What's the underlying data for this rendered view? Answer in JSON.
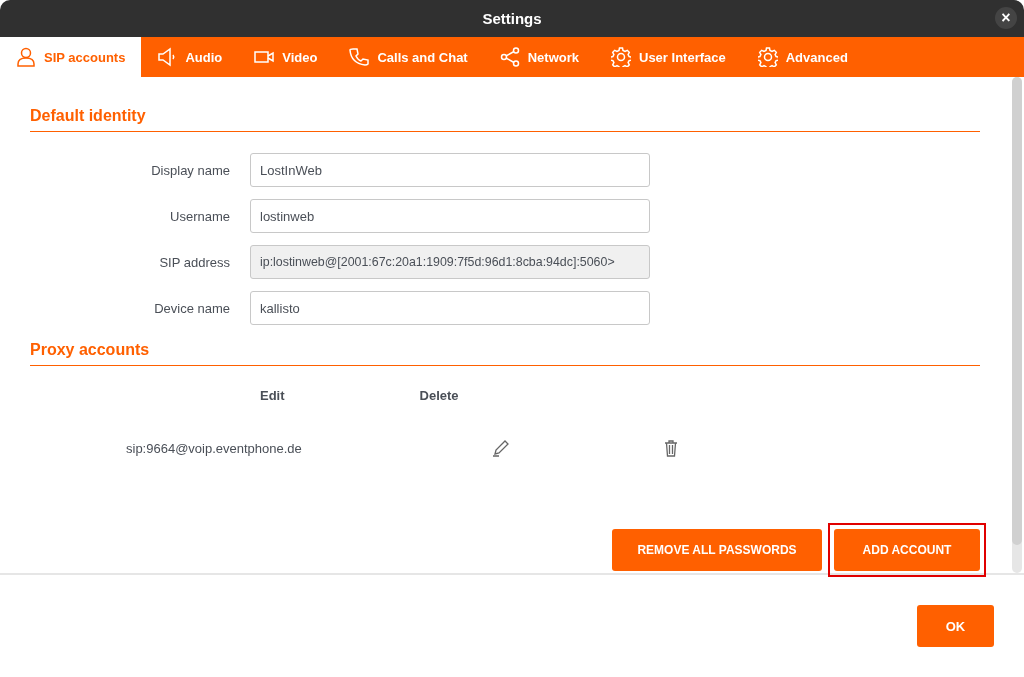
{
  "window": {
    "title": "Settings",
    "close": "×"
  },
  "tabs": [
    {
      "label": "SIP accounts",
      "kind": "user",
      "selected": true
    },
    {
      "label": "Audio",
      "kind": "speaker",
      "selected": false
    },
    {
      "label": "Video",
      "kind": "camera",
      "selected": false
    },
    {
      "label": "Calls and Chat",
      "kind": "phone",
      "selected": false
    },
    {
      "label": "Network",
      "kind": "share",
      "selected": false
    },
    {
      "label": "User Interface",
      "kind": "gear",
      "selected": false
    },
    {
      "label": "Advanced",
      "kind": "gear",
      "selected": false
    }
  ],
  "default_identity": {
    "heading": "Default identity",
    "fields": [
      {
        "label": "Display name",
        "value": "LostInWeb",
        "disabled": false
      },
      {
        "label": "Username",
        "value": "lostinweb",
        "disabled": false
      },
      {
        "label": "SIP address",
        "value": "ip:lostinweb@[2001:67c:20a1:1909:7f5d:96d1:8cba:94dc]:5060>",
        "disabled": true
      },
      {
        "label": "Device name",
        "value": "kallisto",
        "disabled": false
      }
    ]
  },
  "proxy_accounts": {
    "heading": "Proxy accounts",
    "columns": [
      "Edit",
      "Delete"
    ],
    "rows": [
      {
        "address": "sip:9664@voip.eventphone.de"
      }
    ]
  },
  "actions": [
    {
      "label": "REMOVE ALL PASSWORDS",
      "highlighted": false
    },
    {
      "label": "ADD ACCOUNT",
      "highlighted": true
    }
  ],
  "footer": {
    "buttons": [
      "OK"
    ]
  }
}
